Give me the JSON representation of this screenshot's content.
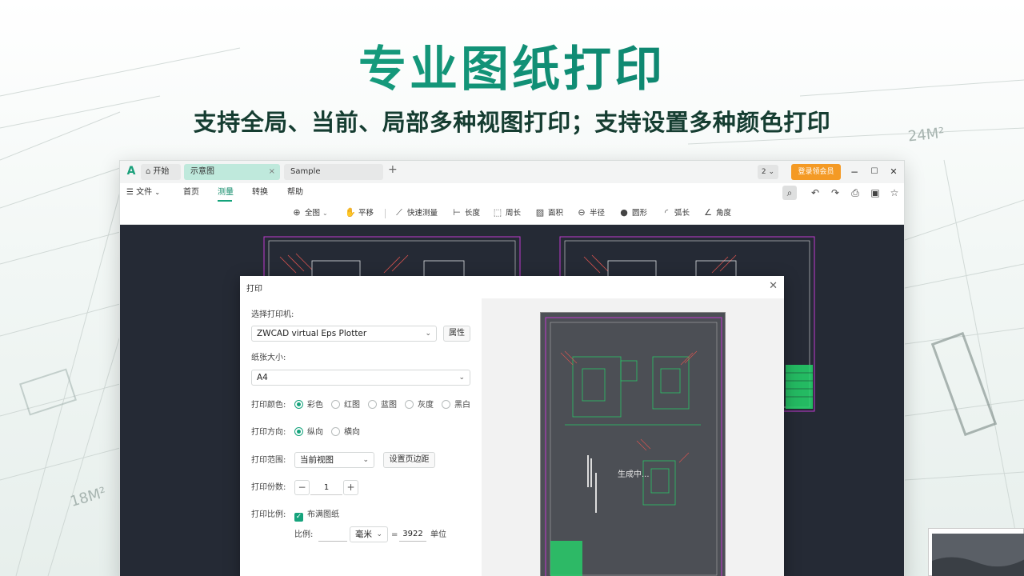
{
  "hero": {
    "title": "专业图纸打印",
    "subtitle": "支持全局、当前、局部多种视图打印；支持设置多种颜色打印"
  },
  "bg_labels": [
    "24M²",
    "18M²"
  ],
  "window": {
    "tabs": [
      {
        "label": "开始",
        "icon": "home-icon"
      },
      {
        "label": "示意图",
        "active": true
      },
      {
        "label": "Sample"
      }
    ],
    "tab_add": "+",
    "count_dropdown": "2",
    "login_button": "登录领会员",
    "controls": {
      "minimize": "−",
      "maximize": "☐",
      "close": "✕"
    },
    "menu": {
      "file": "文件",
      "items": [
        "首页",
        "测量",
        "转换",
        "帮助"
      ],
      "active": "测量"
    },
    "toolbar": [
      {
        "label": "全图",
        "icon": "zoom-extents-icon"
      },
      {
        "label": "平移",
        "icon": "pan-hand-icon"
      },
      {
        "label": "快速测量",
        "icon": "ruler-icon"
      },
      {
        "label": "长度",
        "icon": "length-icon"
      },
      {
        "label": "周长",
        "icon": "perimeter-icon"
      },
      {
        "label": "面积",
        "icon": "area-icon"
      },
      {
        "label": "半径",
        "icon": "radius-icon"
      },
      {
        "label": "圆形",
        "icon": "circle-icon"
      },
      {
        "label": "弧长",
        "icon": "arc-icon"
      },
      {
        "label": "角度",
        "icon": "angle-icon"
      }
    ]
  },
  "print_dialog": {
    "title": "打印",
    "printer_label": "选择打印机:",
    "printer_value": "ZWCAD virtual Eps Plotter",
    "printer_props": "属性",
    "paper_label": "纸张大小:",
    "paper_value": "A4",
    "color_label": "打印颜色:",
    "color_options": [
      "彩色",
      "红图",
      "蓝图",
      "灰度",
      "黑白"
    ],
    "color_selected": "彩色",
    "orient_label": "打印方向:",
    "orient_options": [
      "纵向",
      "横向"
    ],
    "orient_selected": "纵向",
    "range_label": "打印范围:",
    "range_value": "当前视图",
    "margin_button": "设置页边距",
    "copies_label": "打印份数:",
    "copies_value": "1",
    "scale_label": "打印比例:",
    "fit_paper": "布满图纸",
    "fit_checked": true,
    "ratio_label": "比例:",
    "ratio_left": "",
    "unit_value": "毫米",
    "equals": "=",
    "ratio_right": "3922",
    "unit_suffix": "单位",
    "preview_status": "生成中..."
  },
  "colors": {
    "accent": "#16a37c",
    "login": "#f49a25",
    "canvas": "#252a35",
    "cad_magenta": "#c03ad0",
    "cad_green": "#25d36a"
  }
}
